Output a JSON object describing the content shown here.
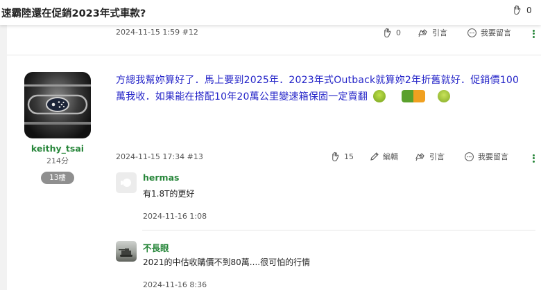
{
  "topbar": {
    "title": "速霸陸還在促銷2023年式車款?",
    "clap_count": "0"
  },
  "post12": {
    "meta": "2024-11-15 1:59 #12",
    "clap_count": "0",
    "quote_label": "引言",
    "reply_label": "我要留言"
  },
  "post13": {
    "username": "keithy_tsai",
    "points": "214分",
    "floor": "13樓",
    "content_line1": "方總我幫妳算好了．馬上要到2025年．2023年式Outback就算妳2年折舊就好．促銷價100",
    "content_line2": "萬我收．如果能在搭配10年20萬公里變速箱保固一定賣翻",
    "meta": "2024-11-15 17:34 #13",
    "clap_count": "15",
    "edit_label": "編輯",
    "quote_label": "引言",
    "reply_label": "我要留言"
  },
  "comments": [
    {
      "name": "hermas",
      "text": "有1.8T的更好",
      "time": "2024-11-16 1:08"
    },
    {
      "name": "不長眼",
      "text": "2021的中估收購價不到80萬....很可怕的行情",
      "time": "2024-11-16 8:36"
    }
  ],
  "colors": {
    "accent_green": "#27863a",
    "content_blue": "#2424c8"
  }
}
